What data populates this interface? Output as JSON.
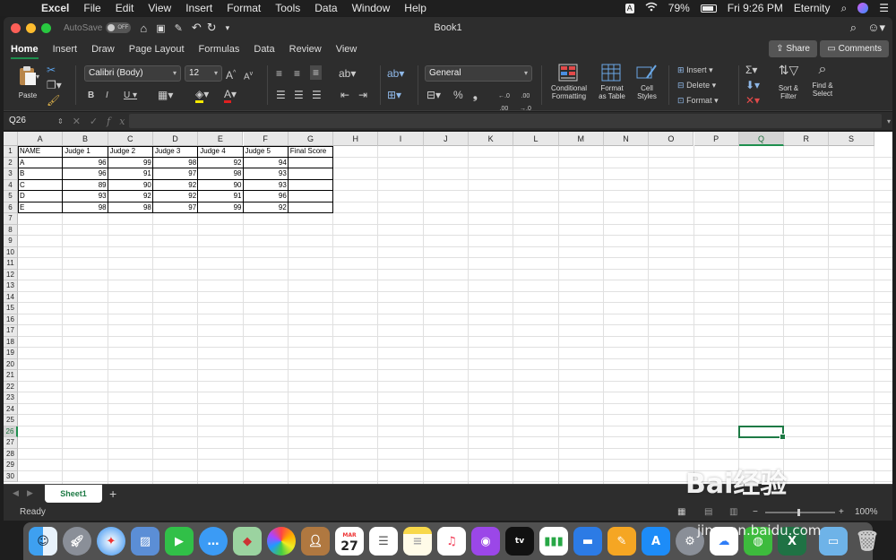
{
  "menubar": {
    "app": "Excel",
    "items": [
      "File",
      "Edit",
      "View",
      "Insert",
      "Format",
      "Tools",
      "Data",
      "Window",
      "Help"
    ],
    "battery": "79%",
    "clock": "Fri 9:26 PM",
    "user": "Eternity",
    "input_indicator": "A"
  },
  "window": {
    "title": "Book1",
    "autosave_label": "AutoSave",
    "autosave_state": "OFF"
  },
  "tabs": [
    "Home",
    "Insert",
    "Draw",
    "Page Layout",
    "Formulas",
    "Data",
    "Review",
    "View"
  ],
  "share_label": "Share",
  "comments_label": "Comments",
  "ribbon": {
    "paste": "Paste",
    "font_name": "Calibri (Body)",
    "font_size": "12",
    "number_format": "General",
    "conditional": [
      "Conditional",
      "Formatting"
    ],
    "format_table": [
      "Format",
      "as Table"
    ],
    "cell_styles": [
      "Cell",
      "Styles"
    ],
    "insert": "Insert",
    "delete": "Delete",
    "format": "Format",
    "sort": [
      "Sort &",
      "Filter"
    ],
    "find": [
      "Find &",
      "Select"
    ]
  },
  "namebox": "Q26",
  "columns": [
    "A",
    "B",
    "C",
    "D",
    "E",
    "F",
    "G",
    "H",
    "I",
    "J",
    "K",
    "L",
    "M",
    "N",
    "O",
    "P",
    "Q",
    "R",
    "S"
  ],
  "selected_column": "Q",
  "selected_row": 26,
  "table": {
    "headers": [
      "NAME",
      "Judge 1",
      "Judge 2",
      "Judge 3",
      "Judge 4",
      "Judge 5",
      "Final Score"
    ],
    "rows": [
      [
        "A",
        96,
        99,
        98,
        92,
        94,
        ""
      ],
      [
        "B",
        96,
        91,
        97,
        98,
        93,
        ""
      ],
      [
        "C",
        89,
        90,
        92,
        90,
        93,
        ""
      ],
      [
        "D",
        93,
        92,
        92,
        91,
        96,
        ""
      ],
      [
        "E",
        98,
        98,
        97,
        99,
        92,
        ""
      ]
    ]
  },
  "sheet_tab": "Sheet1",
  "status": {
    "ready": "Ready",
    "zoom": "100%"
  },
  "watermark": {
    "logo": "Bai经验",
    "url": "jingyan.baidu.com"
  }
}
